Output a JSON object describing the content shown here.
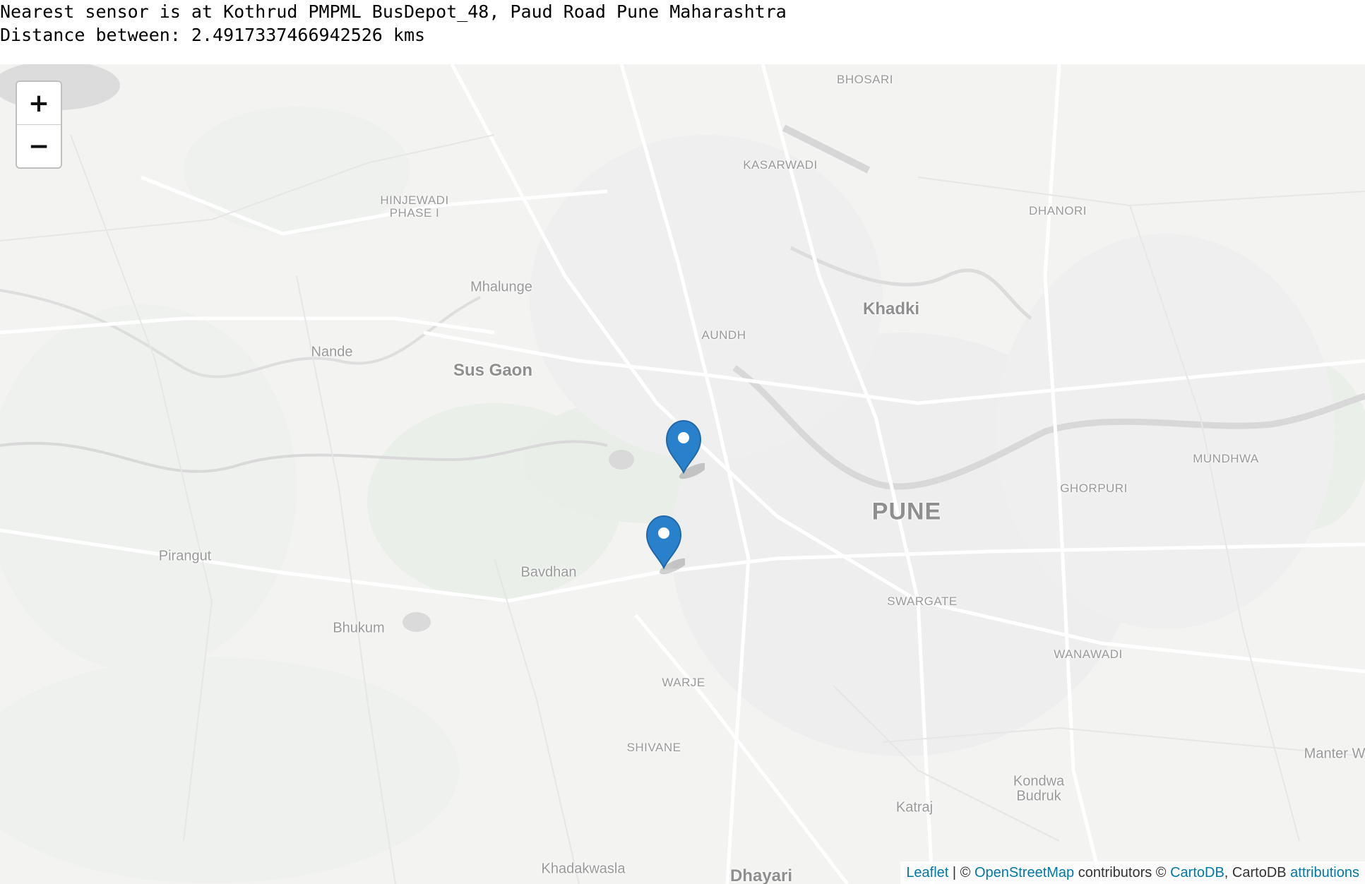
{
  "header": {
    "line1": "Nearest sensor is at Kothrud PMPML BusDepot_48, Paud Road Pune Maharashtra",
    "line2": "Distance between: 2.4917337466942526 kms"
  },
  "map": {
    "zoom_in_label": "+",
    "zoom_out_label": "−",
    "places": {
      "bhosari": "BHOSARI",
      "kasarwadi": "KASARWADI",
      "hinjewadi1": "HINJEWADI",
      "hinjewadi2": "PHASE I",
      "dhanori": "DHANORI",
      "mhalunge": "Mhalunge",
      "khadki": "Khadki",
      "aundh": "AUNDH",
      "nande": "Nande",
      "susgaon": "Sus Gaon",
      "mundhwa": "MUNDHWA",
      "ghorpuri": "GHORPURI",
      "pune": "PUNE",
      "pirangut": "Pirangut",
      "bavdhan": "Bavdhan",
      "swargate": "SWARGATE",
      "bhukum": "Bhukum",
      "wanawadi": "WANAWADI",
      "warje": "WARJE",
      "shivane": "SHIVANE",
      "manterw": "Manter W",
      "kondhwa1": "Kondwa",
      "kondhwa2": "Budruk",
      "katraj": "Katraj",
      "khadakwasla": "Khadakwasla",
      "dhayari": "Dhayari"
    },
    "markers": [
      {
        "name": "user-location",
        "color": "#2a81cb"
      },
      {
        "name": "nearest-sensor",
        "color": "#2a81cb"
      }
    ]
  },
  "attribution": {
    "leaflet": "Leaflet",
    "sep1": " | © ",
    "osm": "OpenStreetMap",
    "mid": " contributors © ",
    "carto": "CartoDB",
    "mid2": ", CartoDB ",
    "attr": "attributions"
  }
}
